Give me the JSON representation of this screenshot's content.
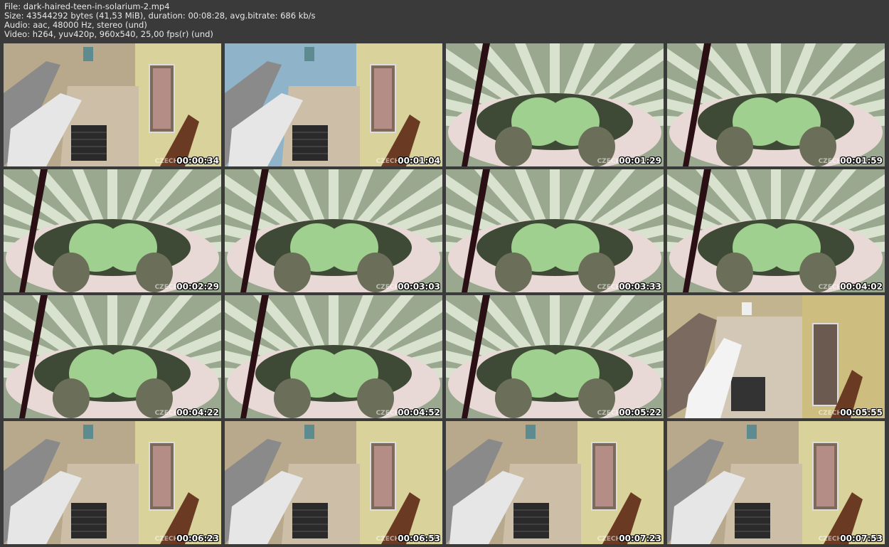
{
  "header": {
    "file": "File: dark-haired-teen-in-solarium-2.mp4",
    "size": "Size: 43544292 bytes (41,53 MiB), duration: 00:08:28, avg.bitrate: 686 kb/s",
    "audio": "Audio: aac, 48000 Hz, stereo (und)",
    "video": "Video: h264, yuv420p, 960x540, 25,00 fps(r) (und)"
  },
  "watermark": "CZECH",
  "thumbnails": [
    {
      "time": "00:00:34",
      "scene": "room",
      "tint": "#b8a98c"
    },
    {
      "time": "00:01:04",
      "scene": "room",
      "tint": "#8fb3c9"
    },
    {
      "time": "00:01:29",
      "scene": "bed"
    },
    {
      "time": "00:01:59",
      "scene": "bed"
    },
    {
      "time": "00:02:29",
      "scene": "bed"
    },
    {
      "time": "00:03:03",
      "scene": "bed"
    },
    {
      "time": "00:03:33",
      "scene": "bed"
    },
    {
      "time": "00:04:02",
      "scene": "bed"
    },
    {
      "time": "00:04:22",
      "scene": "bed"
    },
    {
      "time": "00:04:52",
      "scene": "bed"
    },
    {
      "time": "00:05:22",
      "scene": "bed"
    },
    {
      "time": "00:05:55",
      "scene": "room2",
      "tint": "#c2b48e"
    },
    {
      "time": "00:06:23",
      "scene": "room",
      "tint": "#b8a98c"
    },
    {
      "time": "00:06:53",
      "scene": "room",
      "tint": "#b8a98c"
    },
    {
      "time": "00:07:23",
      "scene": "room",
      "tint": "#b8a98c"
    },
    {
      "time": "00:07:53",
      "scene": "room",
      "tint": "#b8a98c"
    }
  ]
}
